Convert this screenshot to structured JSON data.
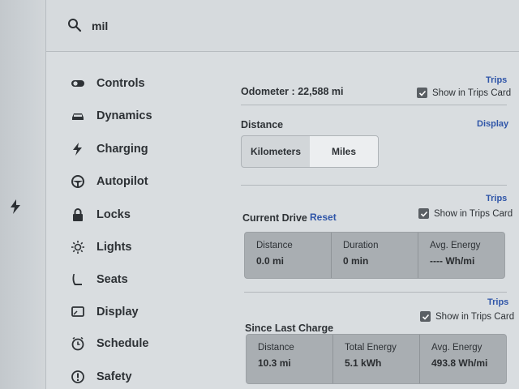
{
  "search": {
    "value": "mil"
  },
  "nav": {
    "items": [
      {
        "label": "Controls",
        "icon": "toggle-icon"
      },
      {
        "label": "Dynamics",
        "icon": "car-icon"
      },
      {
        "label": "Charging",
        "icon": "bolt-icon"
      },
      {
        "label": "Autopilot",
        "icon": "steering-wheel-icon"
      },
      {
        "label": "Locks",
        "icon": "lock-icon"
      },
      {
        "label": "Lights",
        "icon": "light-icon"
      },
      {
        "label": "Seats",
        "icon": "seat-icon"
      },
      {
        "label": "Display",
        "icon": "display-icon"
      },
      {
        "label": "Schedule",
        "icon": "clock-icon"
      },
      {
        "label": "Safety",
        "icon": "alert-icon"
      }
    ]
  },
  "odometer": {
    "link": "Trips",
    "label": "Odometer",
    "separator": ":",
    "value": "22,588 mi",
    "show_label": "Show in Trips Card",
    "checked": true
  },
  "distance": {
    "link": "Display",
    "label": "Distance",
    "options": [
      "Kilometers",
      "Miles"
    ],
    "selected": "Miles"
  },
  "current_drive": {
    "link": "Trips",
    "label": "Current Drive",
    "reset": "Reset",
    "show_label": "Show in Trips Card",
    "stats": [
      {
        "label": "Distance",
        "value": "0.0 mi"
      },
      {
        "label": "Duration",
        "value": "0 min"
      },
      {
        "label": "Avg. Energy",
        "value": "---- Wh/mi"
      }
    ]
  },
  "since_last_charge": {
    "link": "Trips",
    "label": "Since Last Charge",
    "show_label": "Show in Trips Card",
    "stats": [
      {
        "label": "Distance",
        "value": "10.3 mi"
      },
      {
        "label": "Total Energy",
        "value": "5.1 kWh"
      },
      {
        "label": "Avg. Energy",
        "value": "493.8 Wh/mi"
      }
    ]
  },
  "colors": {
    "link": "#2f55a8",
    "checkbox": "#5a5f64",
    "panel": "#a9aeb2"
  }
}
